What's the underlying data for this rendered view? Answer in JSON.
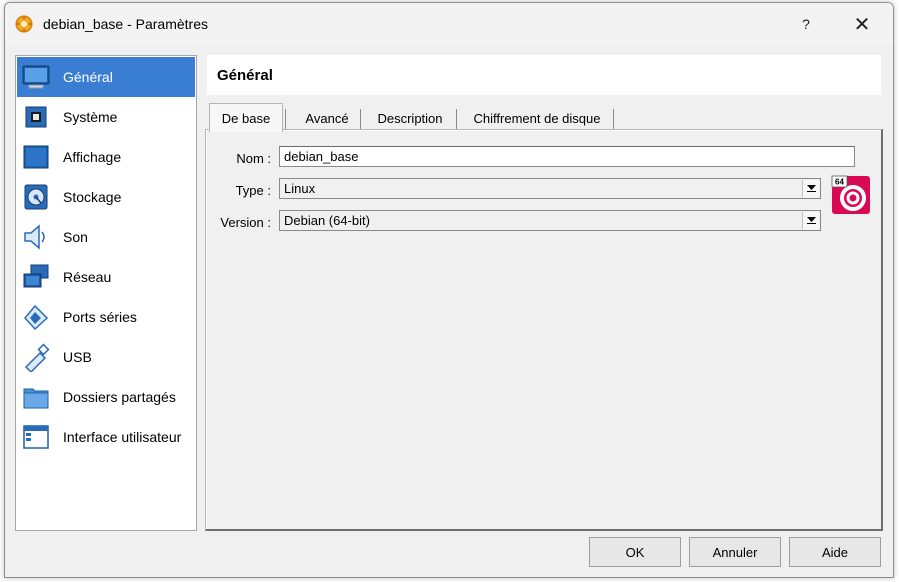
{
  "window": {
    "title": "debian_base - Paramètres"
  },
  "titlebar": {
    "help_label": "?",
    "close_label": "✕"
  },
  "sidebar": {
    "items": [
      {
        "label": "Général",
        "icon": "general-icon"
      },
      {
        "label": "Système",
        "icon": "chip-icon"
      },
      {
        "label": "Affichage",
        "icon": "monitor-icon"
      },
      {
        "label": "Stockage",
        "icon": "disk-icon"
      },
      {
        "label": "Son",
        "icon": "speaker-icon"
      },
      {
        "label": "Réseau",
        "icon": "network-icon"
      },
      {
        "label": "Ports séries",
        "icon": "serial-port-icon"
      },
      {
        "label": "USB",
        "icon": "usb-icon"
      },
      {
        "label": "Dossiers partagés",
        "icon": "folder-icon"
      },
      {
        "label": "Interface utilisateur",
        "icon": "ui-window-icon"
      }
    ],
    "active_index": 0
  },
  "header": {
    "title": "Général"
  },
  "tabs": [
    {
      "label": "De base",
      "active": true
    },
    {
      "label": "Avancé",
      "active": false
    },
    {
      "label": "Description",
      "active": false
    },
    {
      "label": "Chiffrement de disque",
      "active": false
    }
  ],
  "form": {
    "name_label": "Nom :",
    "name_value": "debian_base",
    "type_label": "Type :",
    "type_value": "Linux",
    "version_label": "Version :",
    "version_value": "Debian (64-bit)",
    "os_badge": "64"
  },
  "buttons": {
    "ok": "OK",
    "cancel": "Annuler",
    "help": "Aide"
  },
  "colors": {
    "selection": "#3a7ed4",
    "window_bg": "#f0f0f0",
    "debian_red": "#d70a53"
  }
}
